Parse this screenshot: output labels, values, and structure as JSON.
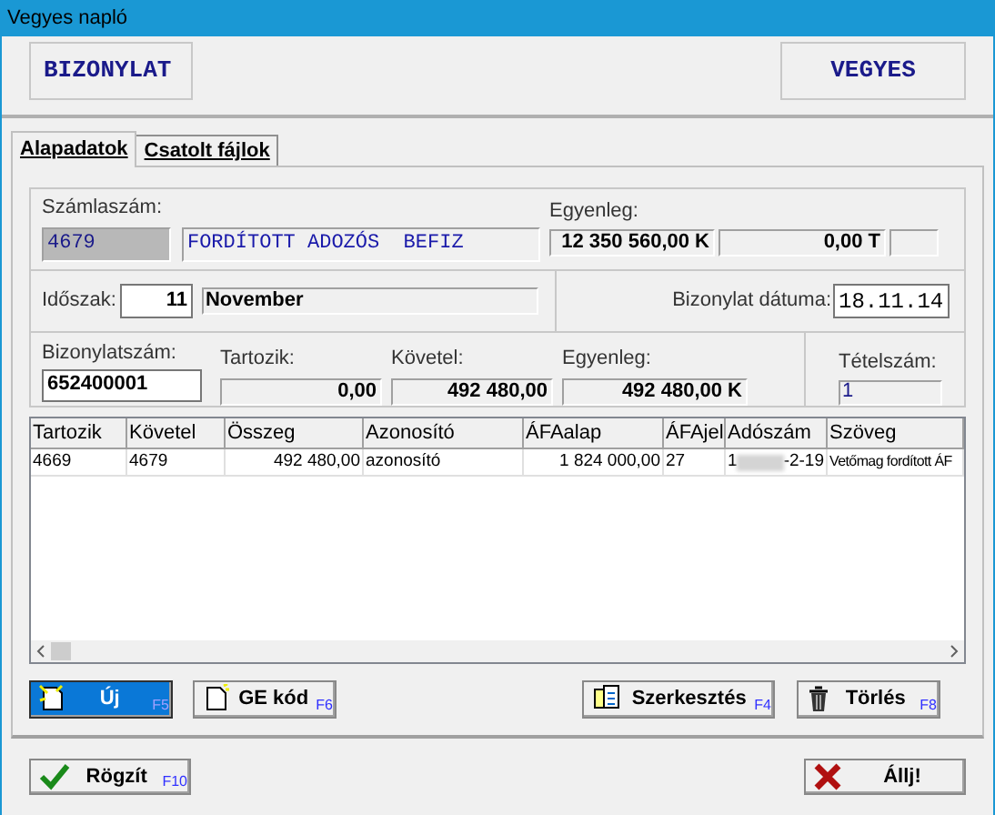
{
  "window": {
    "title": "Vegyes napló"
  },
  "header": {
    "left": "BIZONYLAT",
    "right": "VEGYES"
  },
  "tabs": [
    {
      "label": "Alapadatok",
      "selected": true
    },
    {
      "label": "Csatolt fájlok",
      "selected": false
    }
  ],
  "account": {
    "label": "Számlaszám:",
    "number": "4679",
    "name": "FORDÍTOTT ADOZÓS  BEFIZ",
    "balance_label": "Egyenleg:",
    "balance": "12 350 560,00 K",
    "balance2": "0,00 T"
  },
  "period": {
    "label": "Időszak:",
    "value": "11",
    "month": "November",
    "date_label": "Bizonylat dátuma:",
    "date": "18.11.14"
  },
  "document": {
    "number_label": "Bizonylatszám:",
    "number": "652400001",
    "debit_label": "Tartozik:",
    "debit": "0,00",
    "credit_label": "Követel:",
    "credit": "492 480,00",
    "balance_label": "Egyenleg:",
    "balance": "492 480,00 K",
    "items_label": "Tételszám:",
    "items": "1"
  },
  "table": {
    "columns": [
      "Tartozik",
      "Követel",
      "Összeg",
      "Azonosító",
      "ÁFAalap",
      "ÁFAjel",
      "Adószám",
      "Szöveg"
    ],
    "rows": [
      {
        "selected": false,
        "cells": [
          {
            "text": "4669"
          },
          {
            "text": "4679"
          },
          {
            "text": "492 480,00"
          },
          {
            "text": "azonosító"
          },
          {
            "text": "1 824 000,00"
          },
          {
            "text": "27"
          },
          {
            "text": "1",
            "hidden_end": "-2-19"
          },
          {
            "text": "Vetőmag fordított ÁF"
          }
        ]
      }
    ]
  },
  "actions": [
    {
      "label": "Új",
      "key": "F5",
      "focused": true
    },
    {
      "label": "GE kód",
      "key": "F6",
      "focused": false
    },
    {
      "label": "Szerkesztés",
      "key": "F4",
      "focused": false
    },
    {
      "label": "Törlés",
      "key": "F8",
      "focused": false
    }
  ],
  "footer": [
    {
      "label": "Rögzít",
      "key": "F10"
    },
    {
      "label": "Állj!"
    }
  ]
}
